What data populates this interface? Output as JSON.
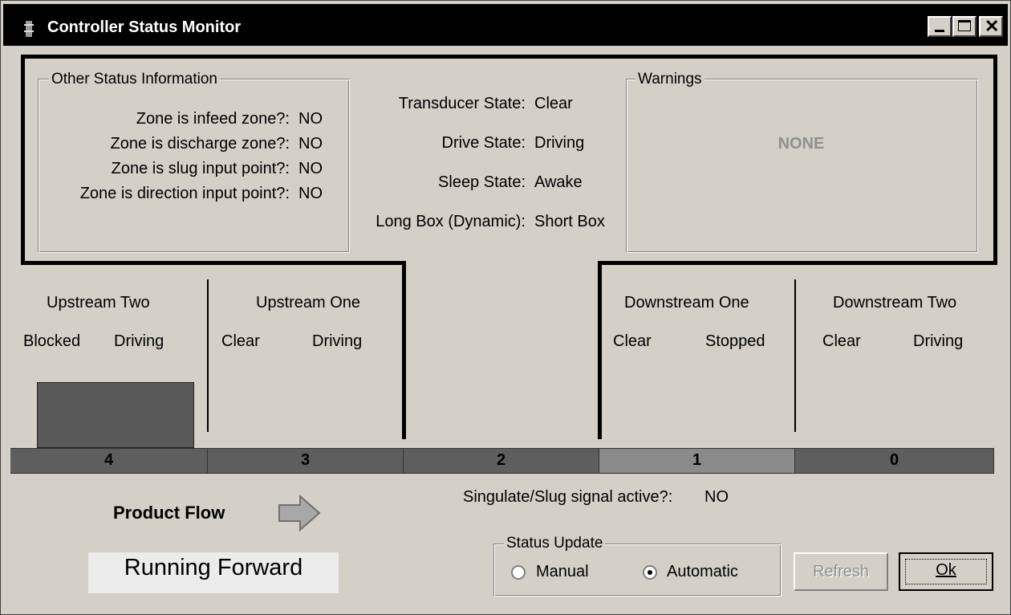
{
  "window": {
    "title": "Controller Status Monitor"
  },
  "other_status": {
    "legend": "Other Status Information",
    "rows": [
      {
        "label": "Zone is infeed zone?:",
        "value": "NO"
      },
      {
        "label": "Zone is discharge zone?:",
        "value": "NO"
      },
      {
        "label": "Zone is slug input point?:",
        "value": "NO"
      },
      {
        "label": "Zone is direction input point?:",
        "value": "NO"
      }
    ]
  },
  "states": [
    {
      "label": "Transducer State:",
      "value": "Clear"
    },
    {
      "label": "Drive State:",
      "value": "Driving"
    },
    {
      "label": "Sleep State:",
      "value": "Awake"
    },
    {
      "label": "Long Box (Dynamic):",
      "value": "Short Box"
    }
  ],
  "warnings": {
    "legend": "Warnings",
    "text": "NONE"
  },
  "zones": {
    "upstream_two": {
      "name": "Upstream Two",
      "sensor": "Blocked",
      "drive": "Driving"
    },
    "upstream_one": {
      "name": "Upstream One",
      "sensor": "Clear",
      "drive": "Driving"
    },
    "downstream_one": {
      "name": "Downstream One",
      "sensor": "Clear",
      "drive": "Stopped"
    },
    "downstream_two": {
      "name": "Downstream Two",
      "sensor": "Clear",
      "drive": "Driving"
    }
  },
  "conveyor_cells": [
    "4",
    "3",
    "2",
    "1",
    "0"
  ],
  "product_flow": {
    "label": "Product Flow",
    "status": "Running Forward"
  },
  "singulate": {
    "label": "Singulate/Slug signal active?:",
    "value": "NO"
  },
  "status_update": {
    "legend": "Status Update",
    "options": [
      "Manual",
      "Automatic"
    ],
    "selected": "Automatic"
  },
  "buttons": {
    "refresh": "Refresh",
    "ok": "Ok"
  },
  "colors": {
    "cell": "#5e5e5e",
    "cell_active": "#8a8a8a",
    "box": "#595959",
    "disabled_text": "#909090"
  }
}
